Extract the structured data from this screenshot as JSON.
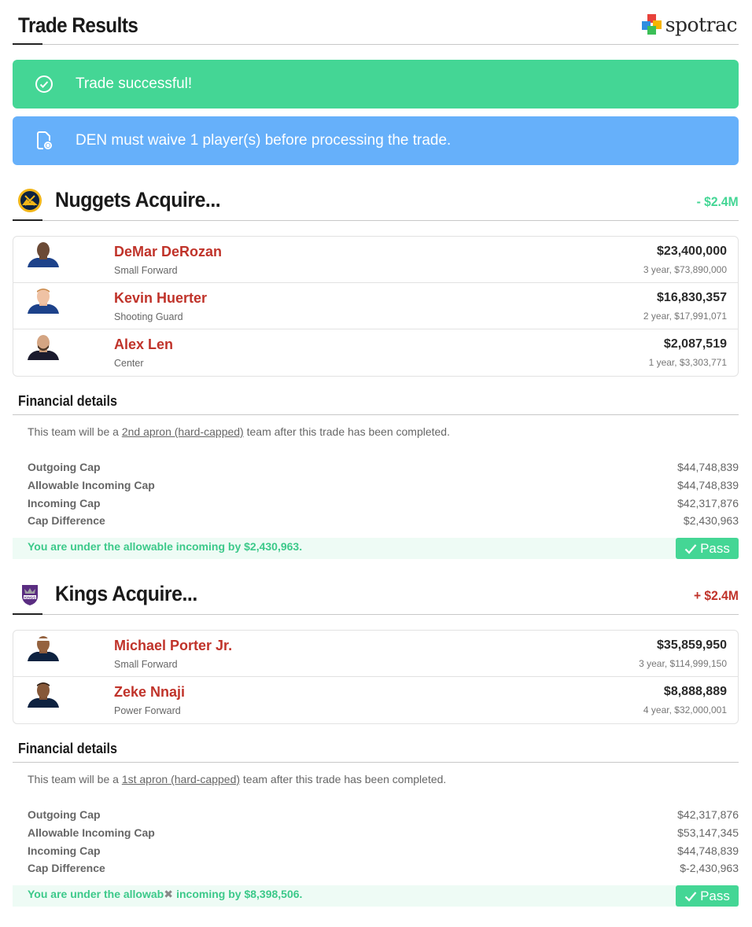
{
  "header": {
    "title": "Trade Results",
    "brand": "spotrac"
  },
  "alerts": {
    "success": {
      "text": "Trade successful!",
      "icon": "check-circle-icon"
    },
    "info": {
      "text": "DEN must waive 1 player(s) before processing the trade.",
      "icon": "document-icon"
    }
  },
  "colors": {
    "success": "#44d695",
    "info": "#66b0fa",
    "player_name": "#c0332a",
    "negative": "#c0332a"
  },
  "teams": [
    {
      "name": "Nuggets Acquire...",
      "delta": "- $2.4M",
      "players": [
        {
          "name": "DeMar DeRozan",
          "position": "Small Forward",
          "salary": "$23,400,000",
          "contract": "3 year, $73,890,000"
        },
        {
          "name": "Kevin Huerter",
          "position": "Shooting Guard",
          "salary": "$16,830,357",
          "contract": "2 year, $17,991,071"
        },
        {
          "name": "Alex Len",
          "position": "Center",
          "salary": "$2,087,519",
          "contract": "1 year, $3,303,771"
        }
      ],
      "financial": {
        "heading": "Financial details",
        "note_prefix": "This team will be a ",
        "note_link": "2nd apron (hard-capped)",
        "note_suffix": " team after this trade has been completed.",
        "rows": [
          {
            "label": "Outgoing Cap",
            "value": "$44,748,839"
          },
          {
            "label": "Allowable Incoming Cap",
            "value": "$44,748,839"
          },
          {
            "label": "Incoming Cap",
            "value": "$42,317,876"
          },
          {
            "label": "Cap Difference",
            "value": "$2,430,963"
          }
        ],
        "verdict": "You are under the allowable incoming by $2,430,963.",
        "pass_label": "Pass"
      }
    },
    {
      "name": "Kings Acquire...",
      "delta": "+ $2.4M",
      "players": [
        {
          "name": "Michael Porter Jr.",
          "position": "Small Forward",
          "salary": "$35,859,950",
          "contract": "3 year, $114,999,150"
        },
        {
          "name": "Zeke Nnaji",
          "position": "Power Forward",
          "salary": "$8,888,889",
          "contract": "4 year, $32,000,001"
        }
      ],
      "financial": {
        "heading": "Financial details",
        "note_prefix": "This team will be a ",
        "note_link": "1st apron (hard-capped)",
        "note_suffix": " team after this trade has been completed.",
        "rows": [
          {
            "label": "Outgoing Cap",
            "value": "$42,317,876"
          },
          {
            "label": "Allowable Incoming Cap",
            "value": "$53,147,345"
          },
          {
            "label": "Incoming Cap",
            "value": "$44,748,839"
          },
          {
            "label": "Cap Difference",
            "value": "$-2,430,963"
          }
        ],
        "verdict_start": "You are under the allowab",
        "verdict_end": " incoming by $8,398,506.",
        "pass_label": "Pass"
      }
    }
  ]
}
